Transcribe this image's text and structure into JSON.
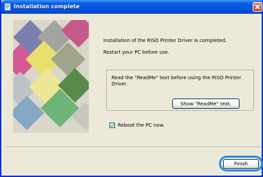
{
  "window": {
    "title": "Installation complete"
  },
  "messages": {
    "line1": "Installation of the RISO Printer Driver is completed.",
    "line2": "Restart your PC before use."
  },
  "readme": {
    "text_line1": "Read the \"ReadMe\" text before using the RISO Printer",
    "text_line2": "Driver.",
    "button_label": "Show \"ReadMe\" text."
  },
  "reboot": {
    "checked": true,
    "label": "Reboot the PC now."
  },
  "footer": {
    "finish_label": "Finish"
  },
  "colors": {
    "titlebar": "#0055e5",
    "dialog_bg": "#ece9d8",
    "highlight_ring": "#2a8fd8"
  }
}
